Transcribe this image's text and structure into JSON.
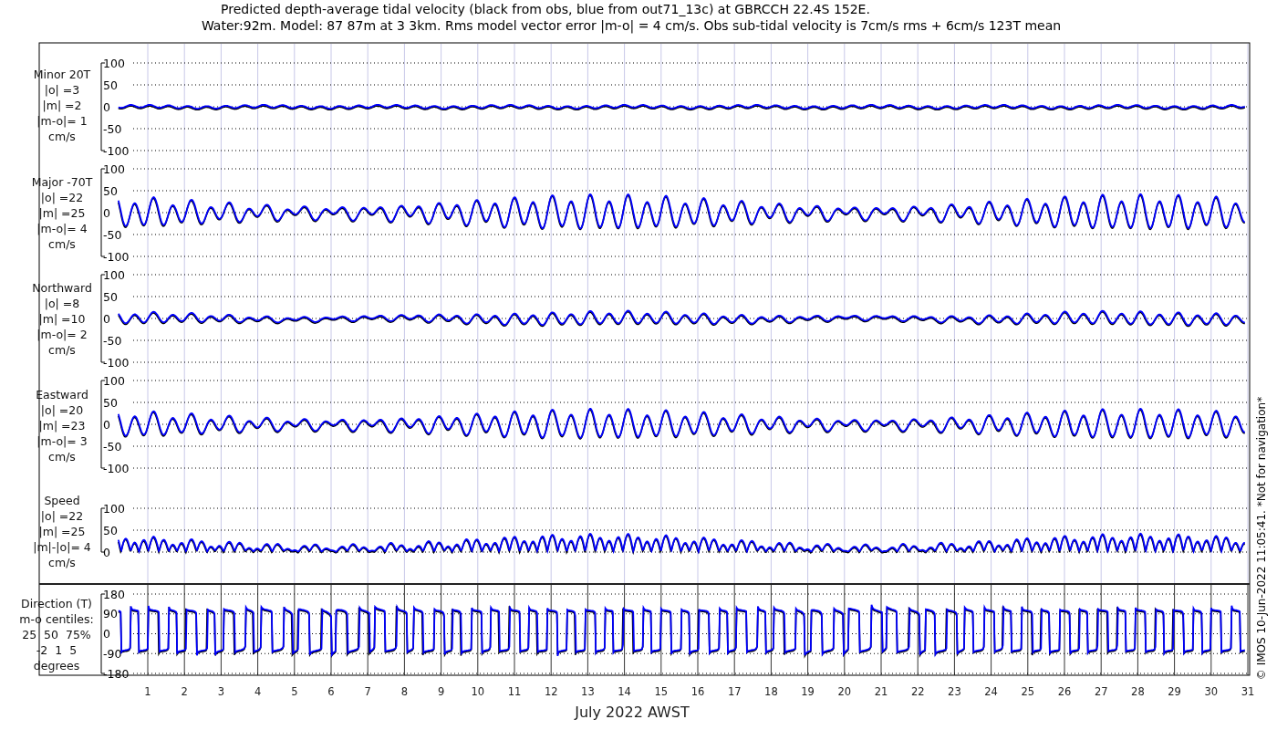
{
  "title": [
    "Predicted depth-average tidal velocity (black from obs, blue from out71_13c) at GBRCCH 22.4S 152E.",
    "Water:92m. Model: 87 87m at 3 3km. Rms model vector error |m-o| = 4 cm/s. Obs sub-tidal velocity is 7cm/s rms + 6cm/s 123T mean"
  ],
  "panels": [
    {
      "kind": "velocity",
      "label": [
        "Minor 20T",
        "|o| =3",
        "|m| =2",
        "|m-o|= 1",
        "cm/s"
      ],
      "yticks": [
        "100",
        "50",
        "0",
        "-50",
        "-100"
      ]
    },
    {
      "kind": "velocity",
      "label": [
        "Major -70T",
        "|o| =22",
        "|m| =25",
        "|m-o|= 4",
        "cm/s"
      ],
      "yticks": [
        "100",
        "50",
        "0",
        "-50",
        "-100"
      ]
    },
    {
      "kind": "velocity",
      "label": [
        "Northward",
        "|o| =8",
        "|m| =10",
        "|m-o|= 2",
        "cm/s"
      ],
      "yticks": [
        "100",
        "50",
        "0",
        "-50",
        "-100"
      ]
    },
    {
      "kind": "velocity",
      "label": [
        "Eastward",
        "|o| =20",
        "|m| =23",
        "|m-o|= 3",
        "cm/s"
      ],
      "yticks": [
        "100",
        "50",
        "0",
        "-50",
        "-100"
      ]
    },
    {
      "kind": "speed",
      "label": [
        "Speed",
        "|o| =22",
        "|m| =25",
        "|m|-|o|= 4",
        "cm/s"
      ],
      "yticks": [
        "100",
        "50",
        "0"
      ]
    },
    {
      "kind": "direction",
      "label": [
        "Direction (T)",
        "m-o centiles:",
        "25  50  75%",
        "-2  1  5",
        "degrees"
      ],
      "yticks": [
        "180",
        "90",
        "0",
        "-90",
        "-180"
      ]
    }
  ],
  "xticks": [
    "1",
    "2",
    "3",
    "4",
    "5",
    "6",
    "7",
    "8",
    "9",
    "10",
    "11",
    "12",
    "13",
    "14",
    "15",
    "16",
    "17",
    "18",
    "19",
    "20",
    "21",
    "22",
    "23",
    "24",
    "25",
    "26",
    "27",
    "28",
    "29",
    "30",
    "31"
  ],
  "xlabel": "July 2022 AWST",
  "note": "© IMOS 10-Jun-2022 11:05:41. *Not for navigation*"
}
